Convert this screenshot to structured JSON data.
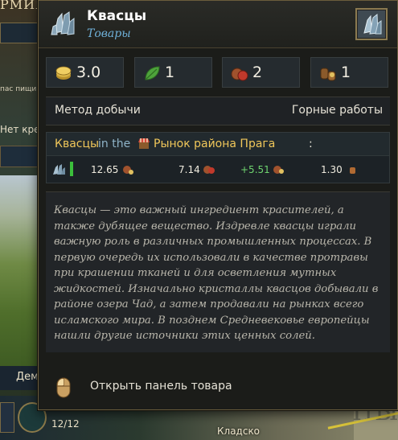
{
  "background": {
    "corner_title": "РМИЯ",
    "sidebar_text_small": "пас пищи",
    "sidebar_text_net": "Нет кре",
    "sidebar_dem_label": "Дем",
    "slot_count": "12/12",
    "city_label": "Кладско",
    "map_lettering": "НЫ"
  },
  "tooltip": {
    "title": "Квасцы",
    "subtitle": "Товары",
    "title_icon": "alum-crystal-icon",
    "stats": [
      {
        "icon": "gold-coin-icon",
        "value": "3.0"
      },
      {
        "icon": "leaf-icon",
        "value": "1"
      },
      {
        "icon": "goods-sack-icon",
        "value": "2"
      },
      {
        "icon": "barrels-icon",
        "value": "1"
      }
    ],
    "method_label": "Метод добычи",
    "method_value": "Горные работы",
    "market": {
      "good": "Квасцы",
      "in": "in the",
      "market_icon": "market-stall-icon",
      "market_name": "Рынок района Прага",
      "colon": ":",
      "values": [
        "12.65",
        "7.14",
        "+5.51",
        "1.30"
      ]
    },
    "description": "Квасцы — это важный ингредиент красителей, а также дубящее вещество. Издревле квасцы играли важную роль в различных промышленных процессах. В первую очередь их использовали в качестве протравы при крашении тканей и для осветления мутных жидкостей. Изначально кристаллы квасцов добывали в районе озера Чад, а затем продавали на рынках всего исламского мира. В позднем Средневековье европейцы нашли другие источники этих ценных солей.",
    "open_panel_label": "Открыть панель товара"
  },
  "colors": {
    "accent_gold": "#f0c75a",
    "subtitle_blue": "#6fb0d8",
    "positive_green": "#6fd46f"
  }
}
